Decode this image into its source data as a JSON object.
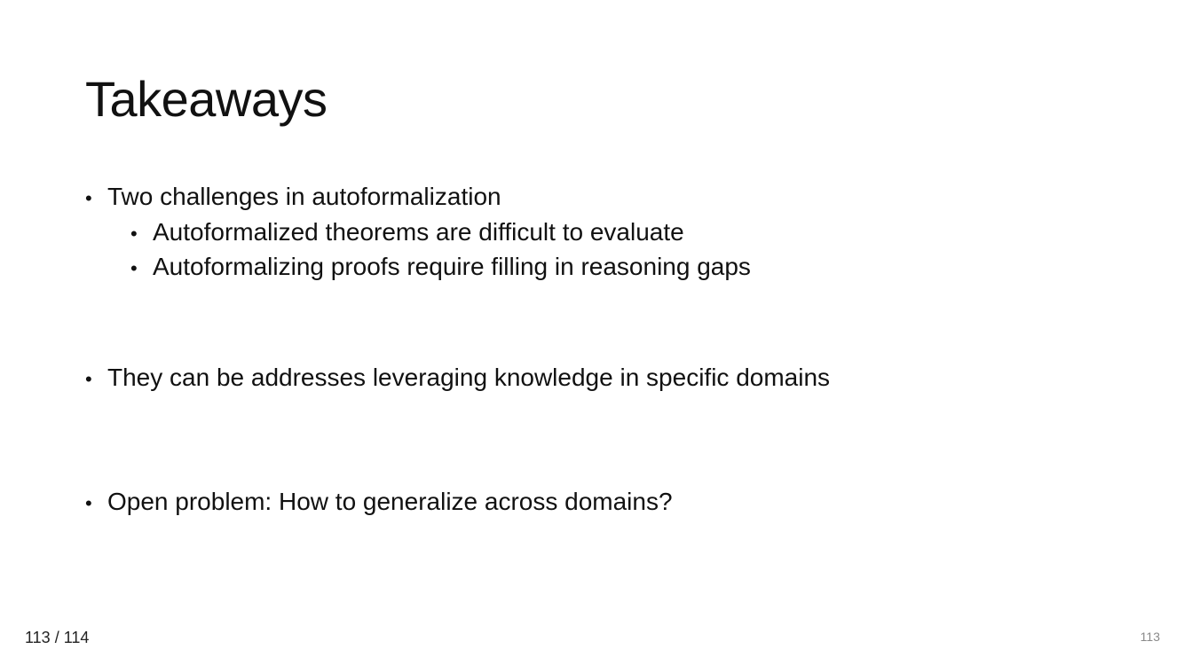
{
  "slide": {
    "title": "Takeaways",
    "bullets": [
      {
        "text": "Two challenges in autoformalization",
        "sub": [
          "Autoformalized theorems are difficult to evaluate",
          "Autoformalizing proofs require filling in reasoning gaps"
        ]
      },
      {
        "text": "They can be addresses leveraging knowledge in specific domains"
      },
      {
        "text": "Open problem: How to generalize across domains?"
      }
    ],
    "bullet_glyph": "•",
    "slide_number": "113"
  },
  "viewer": {
    "page_counter": "113 / 114"
  }
}
